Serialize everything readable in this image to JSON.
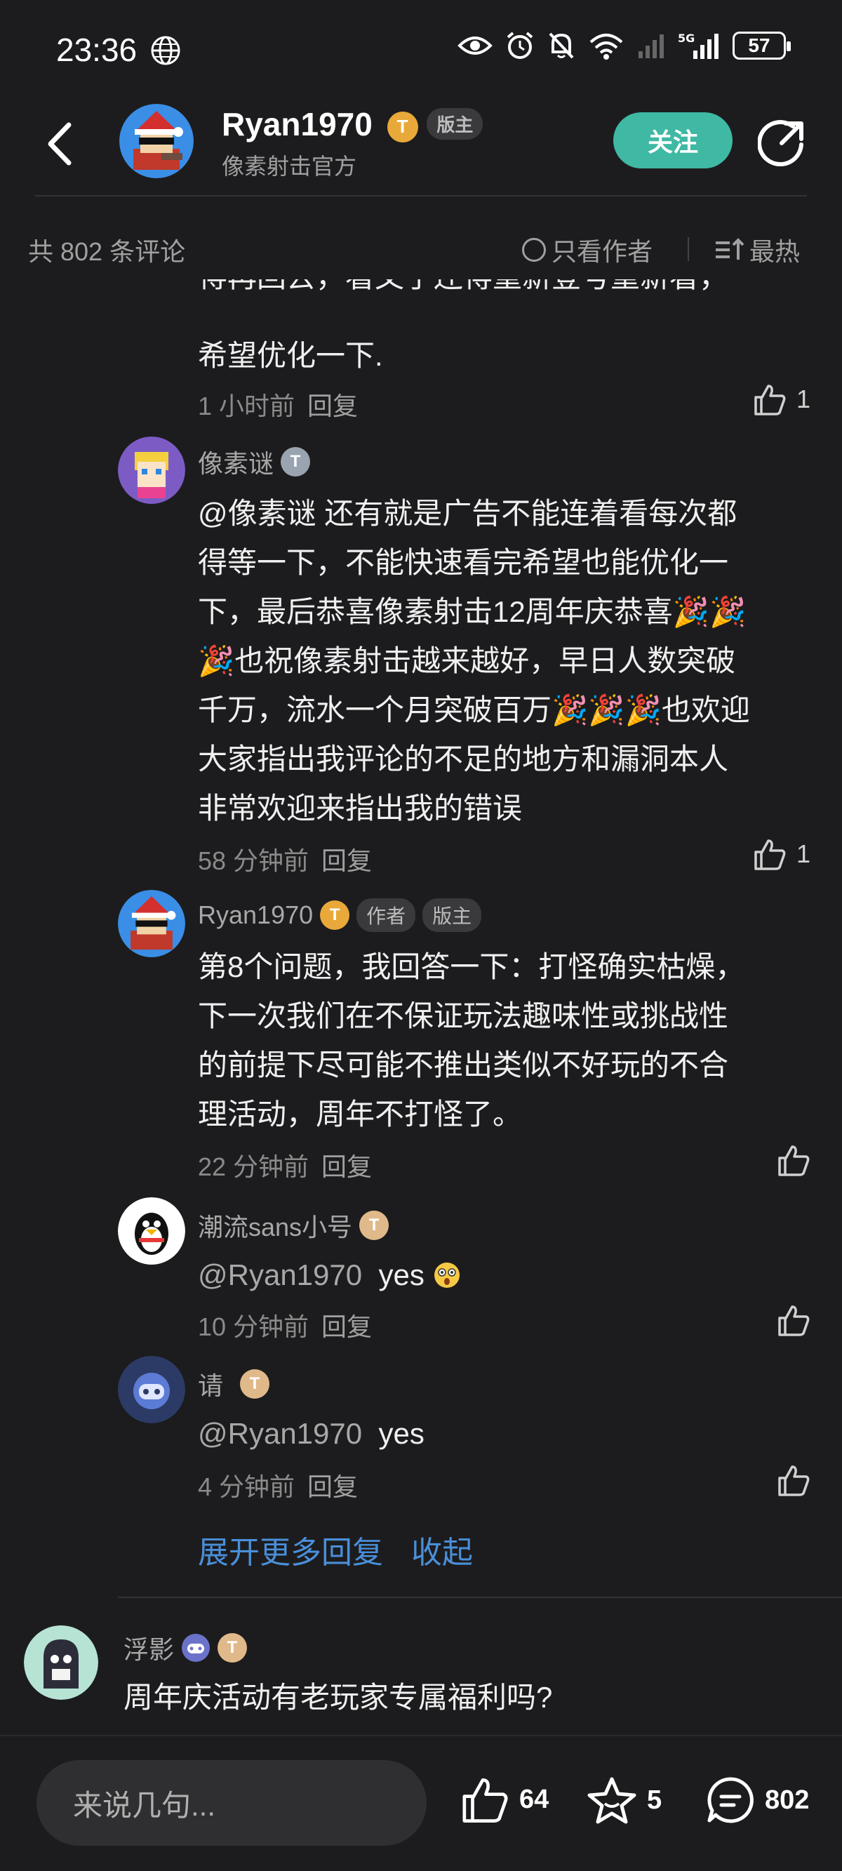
{
  "status_bar": {
    "time": "23:36",
    "battery": "57"
  },
  "header": {
    "name": "Ryan1970",
    "level": "T",
    "tag": "版主",
    "subtitle": "像素射击官方",
    "follow_label": "关注"
  },
  "filter": {
    "count": "共 802 条评论",
    "author_only": "只看作者",
    "sort": "最热"
  },
  "comments": [
    {
      "text_top": "得再回去，看文了还得重新登号重新看，",
      "text": "希望优化一下.",
      "time": "1 小时前",
      "reply": "回复",
      "likes": "1"
    },
    {
      "user": "像素谜",
      "level": "T",
      "mention": "@像素谜",
      "text": "还有就是广告不能连着看每次都得等一下，不能快速看完希望也能优化一下，最后恭喜像素射击12周年庆恭喜🎉🎉🎉也祝像素射击越来越好，早日人数突破千万，流水一个月突破百万🎉🎉🎉也欢迎大家指出我评论的不足的地方和漏洞本人非常欢迎来指出我的错误",
      "lines": [
        "@像素谜  还有就是广告不能连着看每次都",
        "得等一下，不能快速看完希望也能优化一",
        "下，最后恭喜像素射击12周年庆恭喜🎉🎉",
        "🎉也祝像素射击越来越好，早日人数突破",
        "千万，流水一个月突破百万🎉🎉🎉也欢迎",
        "大家指出我评论的不足的地方和漏洞本人",
        "非常欢迎来指出我的错误"
      ],
      "time": "58 分钟前",
      "reply": "回复",
      "likes": "1"
    },
    {
      "user": "Ryan1970",
      "level": "T",
      "tags": [
        "作者",
        "版主"
      ],
      "lines": [
        "第8个问题，我回答一下：打怪确实枯燥，",
        "下一次我们在不保证玩法趣味性或挑战性",
        "的前提下尽可能不推出类似不好玩的不合",
        "理活动，周年不打怪了。"
      ],
      "time": "22 分钟前",
      "reply": "回复"
    },
    {
      "user": "潮流sans小号",
      "level": "T",
      "mention": "@Ryan1970",
      "text": "yes",
      "time": "10 分钟前",
      "reply": "回复"
    },
    {
      "user": "请",
      "level": "T",
      "mention": "@Ryan1970",
      "text": "yes",
      "time": "4 分钟前",
      "reply": "回复"
    }
  ],
  "expand_more": "展开更多回复",
  "collapse": "收起",
  "next_comment": {
    "user": "浮影",
    "level": "T",
    "text": "周年庆活动有老玩家专属福利吗?"
  },
  "bottom_bar": {
    "placeholder": "来说几句...",
    "likes": "64",
    "favorites": "5",
    "comments": "802"
  }
}
